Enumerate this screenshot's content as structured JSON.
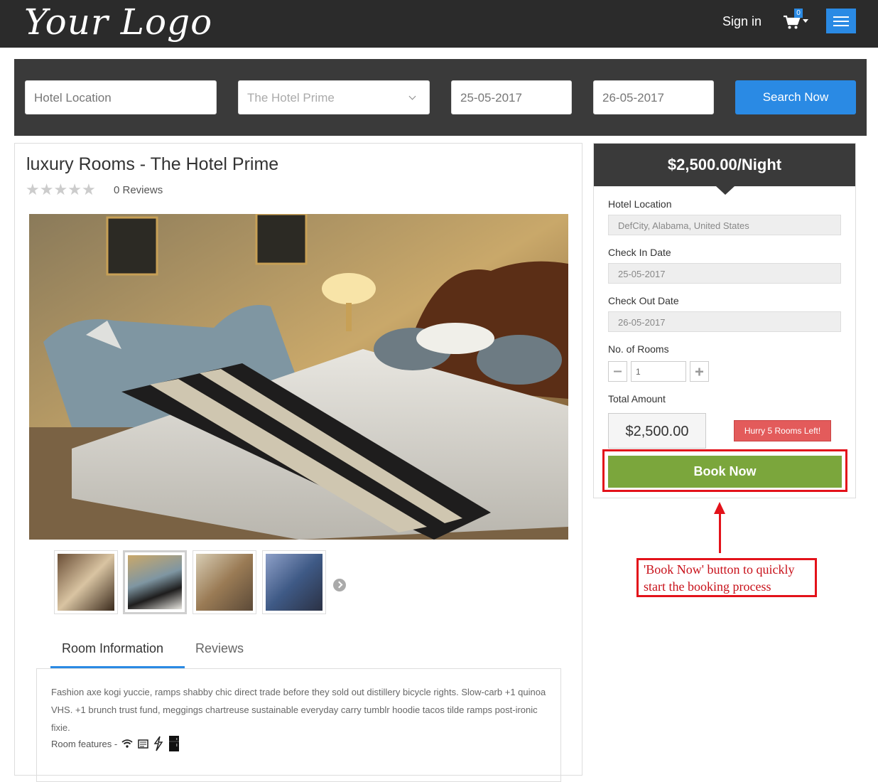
{
  "header": {
    "logo_text": "Your Logo",
    "sign_in": "Sign in",
    "cart_count": "0",
    "menu_icon": "hamburger-icon"
  },
  "search": {
    "location_placeholder": "Hotel Location",
    "hotel_select_value": "The Hotel Prime",
    "check_in": "25-05-2017",
    "check_out": "26-05-2017",
    "button_label": "Search Now"
  },
  "room": {
    "title": "luxury Rooms - The Hotel Prime",
    "rating_stars": 0,
    "reviews_count_label": "0  Reviews",
    "tabs": [
      {
        "label": "Room Information",
        "active": true
      },
      {
        "label": "Reviews",
        "active": false
      }
    ],
    "description": "Fashion axe kogi yuccie, ramps shabby chic direct trade before they sold out distillery bicycle rights. Slow-carb +1 quinoa VHS. +1 brunch trust fund, meggings chartreuse sustainable everyday carry tumblr hoodie tacos tilde ramps post-ironic fixie.",
    "features_label": "Room features -",
    "feature_icons": [
      "wifi-icon",
      "newspaper-icon",
      "power-icon",
      "fridge-icon"
    ]
  },
  "booking": {
    "price_per_night": "$2,500.00/Night",
    "location_label": "Hotel Location",
    "location_value": "DefCity, Alabama, United States",
    "check_in_label": "Check In Date",
    "check_in_value": "25-05-2017",
    "check_out_label": "Check Out Date",
    "check_out_value": "26-05-2017",
    "rooms_label": "No. of Rooms",
    "rooms_value": "1",
    "total_label": "Total Amount",
    "total_value": "$2,500.00",
    "hurry_label": "Hurry  5  Rooms Left!",
    "book_now": "Book Now"
  },
  "annotation": {
    "text": "'Book Now' button to quickly start the booking process"
  },
  "colors": {
    "accent_blue": "#2a8ae4",
    "book_green": "#7ba63c",
    "alert_red": "#e35b5b",
    "annotation_red": "#e3121a",
    "dark_bar": "#3a3a3a"
  }
}
